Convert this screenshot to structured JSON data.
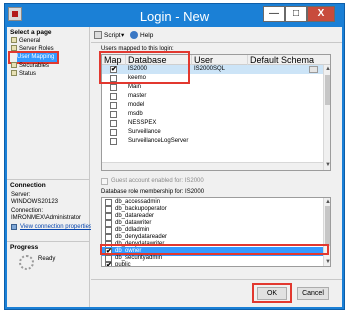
{
  "window": {
    "title": "Login - New",
    "min_glyph": "—",
    "max_glyph": "□",
    "close_glyph": "X"
  },
  "left": {
    "select_page_header": "Select a page",
    "pages": [
      "General",
      "Server Roles",
      "User Mapping",
      "Securables",
      "Status"
    ],
    "connection_header": "Connection",
    "server_label": "Server:",
    "server_value": "WINDOWS20123",
    "connection_label": "Connection:",
    "connection_value": "IMRONMEX\\Administrator",
    "view_link": "View connection properties",
    "progress_header": "Progress",
    "progress_status": "Ready"
  },
  "toolbar": {
    "script_label": "Script",
    "help_label": "Help",
    "dropdown_glyph": "▾"
  },
  "users_mapped_label": "Users mapped to this login:",
  "users_grid": {
    "headers": [
      "Map",
      "Database",
      "User",
      "Default Schema"
    ],
    "rows": [
      {
        "checked": true,
        "database": "IS2000",
        "user": "IS2000SQL",
        "schema": "",
        "mark": "✔"
      },
      {
        "checked": false,
        "database": "keemo",
        "user": "",
        "schema": "",
        "mark": ""
      },
      {
        "checked": false,
        "database": "Main",
        "user": "",
        "schema": "",
        "mark": ""
      },
      {
        "checked": false,
        "database": "master",
        "user": "",
        "schema": "",
        "mark": ""
      },
      {
        "checked": false,
        "database": "model",
        "user": "",
        "schema": "",
        "mark": ""
      },
      {
        "checked": false,
        "database": "msdb",
        "user": "",
        "schema": "",
        "mark": ""
      },
      {
        "checked": false,
        "database": "NESSPEX",
        "user": "",
        "schema": "",
        "mark": ""
      },
      {
        "checked": false,
        "database": "Surveillance",
        "user": "",
        "schema": "",
        "mark": ""
      },
      {
        "checked": false,
        "database": "SurveillanceLogServer",
        "user": "",
        "schema": "",
        "mark": ""
      }
    ]
  },
  "guest_label": "Guest account enabled for: IS2000",
  "role_membership_label": "Database role membership for: IS2000",
  "roles": [
    {
      "name": "db_accessadmin",
      "checked": false,
      "mark": ""
    },
    {
      "name": "db_backupoperator",
      "checked": false,
      "mark": ""
    },
    {
      "name": "db_datareader",
      "checked": false,
      "mark": ""
    },
    {
      "name": "db_datawriter",
      "checked": false,
      "mark": ""
    },
    {
      "name": "db_ddladmin",
      "checked": false,
      "mark": ""
    },
    {
      "name": "db_denydatareader",
      "checked": false,
      "mark": ""
    },
    {
      "name": "db_denydatawriter",
      "checked": false,
      "mark": ""
    },
    {
      "name": "db_owner",
      "checked": true,
      "mark": "✔"
    },
    {
      "name": "db_securityadmin",
      "checked": false,
      "mark": ""
    },
    {
      "name": "public",
      "checked": true,
      "mark": "✔"
    }
  ],
  "buttons": {
    "ok": "OK",
    "cancel": "Cancel"
  },
  "colors": {
    "title_bar": "#1b80d6",
    "highlight": "#e2382f",
    "selection": "#3399ff"
  }
}
